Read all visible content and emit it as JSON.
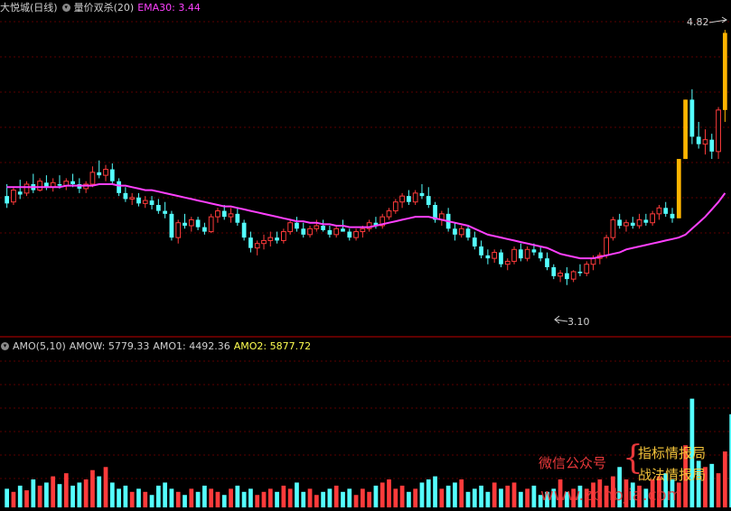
{
  "upper_header": {
    "stock_name": "大悦城(日线)",
    "indicator_name": "量价双杀(20)",
    "ema_label": "EMA30: 3.44"
  },
  "lower_header": {
    "indicator": "AMO(5,10)",
    "amow": "AMOW: 5779.33",
    "amo1": "AMO1: 4492.36",
    "amo2": "AMO2: 5877.72"
  },
  "price_annotations": {
    "high": "4.82",
    "low": "3.10"
  },
  "watermark": {
    "wechat": "微信公众号",
    "line1": "指标情报局",
    "line2": "战法情报局",
    "url": "www.zbhbjia.com"
  },
  "colors": {
    "up": "#ff3b3b",
    "down": "#54ffff",
    "ema": "#ff40ff",
    "limit_up_bar": "#ffb400",
    "grid": "#5a0000",
    "divider": "#c00000",
    "header_text": "#d0d0d0",
    "ema_text": "#ff40ff",
    "amo2_text": "#ffff50"
  },
  "chart_data": [
    {
      "type": "candlestick",
      "title": "大悦城(日线)",
      "ylim": [
        2.8,
        4.9
      ],
      "candles": [
        [
          3.7,
          3.78,
          3.62,
          3.65
        ],
        [
          3.66,
          3.76,
          3.64,
          3.74
        ],
        [
          3.73,
          3.81,
          3.68,
          3.71
        ],
        [
          3.72,
          3.8,
          3.7,
          3.78
        ],
        [
          3.78,
          3.85,
          3.72,
          3.74
        ],
        [
          3.74,
          3.82,
          3.73,
          3.8
        ],
        [
          3.79,
          3.84,
          3.74,
          3.76
        ],
        [
          3.76,
          3.82,
          3.73,
          3.79
        ],
        [
          3.78,
          3.84,
          3.75,
          3.77
        ],
        [
          3.77,
          3.82,
          3.74,
          3.8
        ],
        [
          3.8,
          3.85,
          3.76,
          3.78
        ],
        [
          3.78,
          3.82,
          3.72,
          3.75
        ],
        [
          3.75,
          3.8,
          3.72,
          3.78
        ],
        [
          3.78,
          3.9,
          3.76,
          3.86
        ],
        [
          3.86,
          3.94,
          3.82,
          3.84
        ],
        [
          3.84,
          3.91,
          3.8,
          3.88
        ],
        [
          3.88,
          3.92,
          3.78,
          3.8
        ],
        [
          3.8,
          3.82,
          3.7,
          3.72
        ],
        [
          3.72,
          3.76,
          3.66,
          3.68
        ],
        [
          3.68,
          3.72,
          3.64,
          3.69
        ],
        [
          3.69,
          3.72,
          3.63,
          3.65
        ],
        [
          3.65,
          3.7,
          3.62,
          3.67
        ],
        [
          3.67,
          3.7,
          3.61,
          3.64
        ],
        [
          3.64,
          3.68,
          3.58,
          3.6
        ],
        [
          3.6,
          3.66,
          3.55,
          3.58
        ],
        [
          3.58,
          3.6,
          3.4,
          3.42
        ],
        [
          3.42,
          3.54,
          3.38,
          3.52
        ],
        [
          3.52,
          3.58,
          3.48,
          3.5
        ],
        [
          3.5,
          3.56,
          3.46,
          3.54
        ],
        [
          3.54,
          3.56,
          3.47,
          3.49
        ],
        [
          3.49,
          3.52,
          3.44,
          3.46
        ],
        [
          3.46,
          3.58,
          3.45,
          3.56
        ],
        [
          3.56,
          3.62,
          3.52,
          3.6
        ],
        [
          3.6,
          3.64,
          3.54,
          3.56
        ],
        [
          3.56,
          3.62,
          3.52,
          3.58
        ],
        [
          3.58,
          3.62,
          3.5,
          3.52
        ],
        [
          3.52,
          3.54,
          3.4,
          3.42
        ],
        [
          3.42,
          3.46,
          3.32,
          3.35
        ],
        [
          3.35,
          3.4,
          3.3,
          3.38
        ],
        [
          3.38,
          3.44,
          3.34,
          3.4
        ],
        [
          3.4,
          3.46,
          3.36,
          3.42
        ],
        [
          3.42,
          3.46,
          3.38,
          3.4
        ],
        [
          3.4,
          3.48,
          3.38,
          3.46
        ],
        [
          3.46,
          3.54,
          3.44,
          3.52
        ],
        [
          3.52,
          3.56,
          3.46,
          3.48
        ],
        [
          3.48,
          3.52,
          3.42,
          3.44
        ],
        [
          3.44,
          3.5,
          3.42,
          3.48
        ],
        [
          3.48,
          3.54,
          3.46,
          3.5
        ],
        [
          3.5,
          3.54,
          3.46,
          3.47
        ],
        [
          3.47,
          3.5,
          3.42,
          3.44
        ],
        [
          3.44,
          3.5,
          3.42,
          3.48
        ],
        [
          3.48,
          3.54,
          3.46,
          3.46
        ],
        [
          3.46,
          3.48,
          3.4,
          3.42
        ],
        [
          3.42,
          3.48,
          3.4,
          3.46
        ],
        [
          3.46,
          3.5,
          3.42,
          3.48
        ],
        [
          3.48,
          3.54,
          3.46,
          3.52
        ],
        [
          3.52,
          3.56,
          3.48,
          3.5
        ],
        [
          3.5,
          3.58,
          3.48,
          3.56
        ],
        [
          3.56,
          3.62,
          3.54,
          3.6
        ],
        [
          3.6,
          3.68,
          3.58,
          3.66
        ],
        [
          3.66,
          3.72,
          3.62,
          3.7
        ],
        [
          3.7,
          3.74,
          3.64,
          3.66
        ],
        [
          3.66,
          3.74,
          3.64,
          3.72
        ],
        [
          3.72,
          3.78,
          3.68,
          3.7
        ],
        [
          3.7,
          3.76,
          3.62,
          3.64
        ],
        [
          3.64,
          3.66,
          3.52,
          3.54
        ],
        [
          3.54,
          3.6,
          3.5,
          3.58
        ],
        [
          3.58,
          3.62,
          3.46,
          3.48
        ],
        [
          3.48,
          3.52,
          3.4,
          3.44
        ],
        [
          3.44,
          3.5,
          3.42,
          3.48
        ],
        [
          3.48,
          3.5,
          3.4,
          3.42
        ],
        [
          3.42,
          3.46,
          3.34,
          3.36
        ],
        [
          3.36,
          3.4,
          3.28,
          3.3
        ],
        [
          3.3,
          3.34,
          3.24,
          3.28
        ],
        [
          3.28,
          3.34,
          3.25,
          3.32
        ],
        [
          3.32,
          3.34,
          3.22,
          3.24
        ],
        [
          3.24,
          3.28,
          3.2,
          3.26
        ],
        [
          3.26,
          3.36,
          3.24,
          3.34
        ],
        [
          3.34,
          3.38,
          3.26,
          3.28
        ],
        [
          3.28,
          3.36,
          3.26,
          3.34
        ],
        [
          3.34,
          3.38,
          3.3,
          3.32
        ],
        [
          3.32,
          3.36,
          3.26,
          3.28
        ],
        [
          3.28,
          3.32,
          3.2,
          3.22
        ],
        [
          3.22,
          3.24,
          3.14,
          3.16
        ],
        [
          3.16,
          3.2,
          3.12,
          3.18
        ],
        [
          3.18,
          3.22,
          3.1,
          3.14
        ],
        [
          3.14,
          3.2,
          3.12,
          3.19
        ],
        [
          3.19,
          3.24,
          3.16,
          3.18
        ],
        [
          3.18,
          3.26,
          3.16,
          3.24
        ],
        [
          3.24,
          3.3,
          3.2,
          3.28
        ],
        [
          3.28,
          3.32,
          3.24,
          3.3
        ],
        [
          3.3,
          3.44,
          3.28,
          3.42
        ],
        [
          3.42,
          3.56,
          3.4,
          3.54
        ],
        [
          3.54,
          3.58,
          3.48,
          3.5
        ],
        [
          3.5,
          3.54,
          3.46,
          3.52
        ],
        [
          3.52,
          3.56,
          3.48,
          3.5
        ],
        [
          3.5,
          3.58,
          3.48,
          3.54
        ],
        [
          3.54,
          3.58,
          3.5,
          3.52
        ],
        [
          3.52,
          3.6,
          3.5,
          3.58
        ],
        [
          3.58,
          3.64,
          3.54,
          3.62
        ],
        [
          3.62,
          3.66,
          3.56,
          3.58
        ],
        [
          3.58,
          3.62,
          3.52,
          3.55
        ],
        [
          3.55,
          3.95,
          3.55,
          3.95
        ],
        [
          3.95,
          4.35,
          3.95,
          4.35
        ],
        [
          4.35,
          4.42,
          4.05,
          4.1
        ],
        [
          4.1,
          4.2,
          4.02,
          4.05
        ],
        [
          4.05,
          4.15,
          3.98,
          4.08
        ],
        [
          4.08,
          4.12,
          3.95,
          4.0
        ],
        [
          4.0,
          4.3,
          3.95,
          4.28
        ],
        [
          4.28,
          4.82,
          4.2,
          4.8
        ]
      ],
      "ema": {
        "name": "EMA30",
        "values": [
          3.76,
          3.76,
          3.76,
          3.76,
          3.76,
          3.76,
          3.76,
          3.76,
          3.76,
          3.77,
          3.77,
          3.77,
          3.77,
          3.77,
          3.78,
          3.78,
          3.78,
          3.77,
          3.77,
          3.76,
          3.75,
          3.74,
          3.74,
          3.73,
          3.72,
          3.71,
          3.7,
          3.69,
          3.68,
          3.67,
          3.66,
          3.65,
          3.64,
          3.63,
          3.63,
          3.62,
          3.61,
          3.6,
          3.59,
          3.58,
          3.57,
          3.56,
          3.55,
          3.54,
          3.53,
          3.53,
          3.52,
          3.52,
          3.51,
          3.51,
          3.5,
          3.5,
          3.49,
          3.49,
          3.49,
          3.49,
          3.5,
          3.51,
          3.52,
          3.53,
          3.54,
          3.55,
          3.56,
          3.56,
          3.56,
          3.55,
          3.54,
          3.53,
          3.52,
          3.51,
          3.5,
          3.48,
          3.46,
          3.44,
          3.43,
          3.42,
          3.41,
          3.4,
          3.39,
          3.38,
          3.37,
          3.36,
          3.35,
          3.33,
          3.31,
          3.3,
          3.29,
          3.28,
          3.28,
          3.28,
          3.29,
          3.3,
          3.31,
          3.32,
          3.34,
          3.35,
          3.36,
          3.37,
          3.38,
          3.39,
          3.4,
          3.41,
          3.42,
          3.44,
          3.48,
          3.52,
          3.56,
          3.61,
          3.66,
          3.72
        ]
      }
    },
    {
      "type": "bar",
      "title": "AMO(5,10)",
      "ylim": [
        0,
        100
      ],
      "values": [
        12,
        10,
        14,
        11,
        18,
        14,
        16,
        20,
        15,
        22,
        14,
        16,
        18,
        24,
        20,
        26,
        16,
        12,
        14,
        10,
        12,
        10,
        8,
        14,
        16,
        12,
        10,
        8,
        12,
        10,
        14,
        12,
        10,
        8,
        12,
        14,
        10,
        12,
        8,
        10,
        12,
        10,
        14,
        12,
        16,
        10,
        12,
        8,
        10,
        12,
        14,
        10,
        12,
        8,
        12,
        10,
        14,
        16,
        18,
        12,
        14,
        10,
        12,
        16,
        18,
        20,
        12,
        14,
        16,
        18,
        10,
        12,
        14,
        10,
        16,
        12,
        14,
        16,
        10,
        12,
        14,
        8,
        10,
        12,
        18,
        10,
        12,
        14,
        12,
        16,
        18,
        14,
        20,
        26,
        18,
        16,
        14,
        12,
        18,
        20,
        22,
        18,
        16,
        40,
        70,
        30,
        26,
        28,
        22,
        36,
        60
      ],
      "series": [
        {
          "name": "AMOW",
          "value": "5779.33"
        },
        {
          "name": "AMO1",
          "value": "4492.36"
        },
        {
          "name": "AMO2",
          "value": "5877.72"
        }
      ]
    }
  ]
}
